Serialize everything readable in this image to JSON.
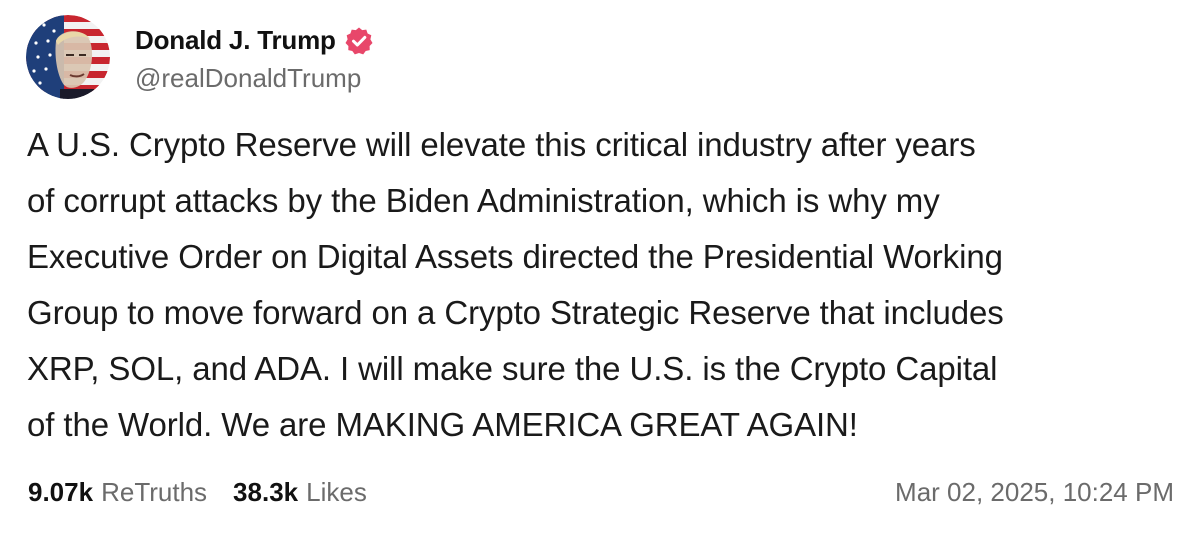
{
  "post": {
    "author": {
      "display_name": "Donald J. Trump",
      "handle": "@realDonaldTrump",
      "verified": true,
      "verified_color": "#e8476a"
    },
    "body_lines": [
      "A U.S. Crypto Reserve will elevate this critical industry after years",
      "of corrupt attacks by the Biden Administration, which is why my",
      "Executive Order on Digital Assets directed the Presidential Working",
      "Group to move forward on a Crypto Strategic Reserve that includes",
      "XRP, SOL, and ADA. I will make sure the U.S. is the Crypto Capital",
      "of the World. We are MAKING AMERICA GREAT AGAIN!"
    ],
    "stats": {
      "retruths_count": "9.07k",
      "retruths_label": "ReTruths",
      "likes_count": "38.3k",
      "likes_label": "Likes"
    },
    "timestamp": "Mar 02, 2025, 10:24 PM"
  },
  "icons": {
    "avatar": "flag-portrait-avatar",
    "verified": "verified-badge-icon"
  }
}
